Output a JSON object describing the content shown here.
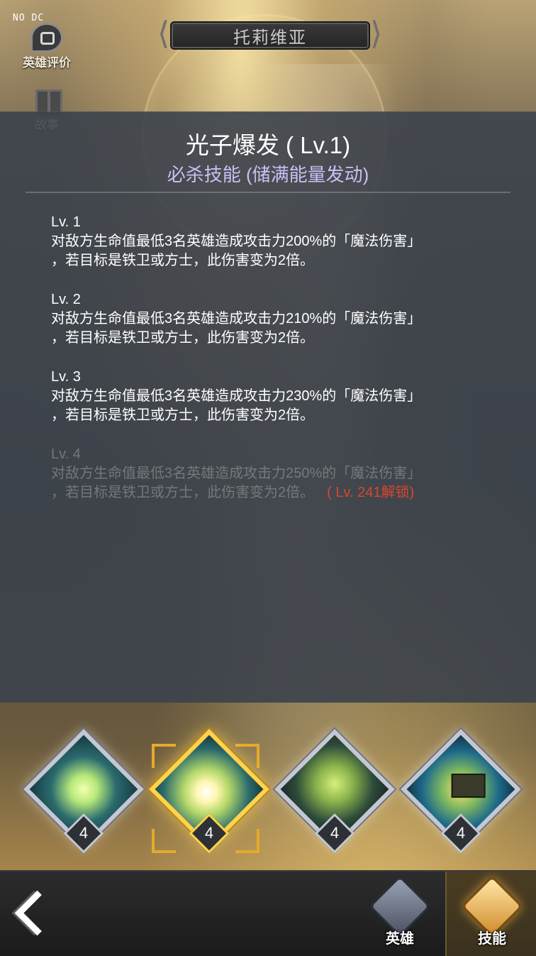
{
  "status": {
    "corner_text": "NO DC"
  },
  "side_menu": {
    "review_label": "英雄评价",
    "story_label": "故事"
  },
  "hero": {
    "name": "托莉维亚"
  },
  "skill_detail": {
    "title": "光子爆发 ( Lv.1)",
    "type": "必杀技能 (储满能量发动)",
    "levels": [
      {
        "label": "Lv. 1",
        "text": "对敌方生命值最低3名英雄造成攻击力200%的「魔法伤害」\n，若目标是铁卫或方士，此伤害变为2倍。",
        "locked": false
      },
      {
        "label": "Lv. 2",
        "text": "对敌方生命值最低3名英雄造成攻击力210%的「魔法伤害」\n，若目标是铁卫或方士，此伤害变为2倍。",
        "locked": false
      },
      {
        "label": "Lv. 3",
        "text": "对敌方生命值最低3名英雄造成攻击力230%的「魔法伤害」\n，若目标是铁卫或方士，此伤害变为2倍。",
        "locked": false
      },
      {
        "label": "Lv. 4",
        "line1": "对敌方生命值最低3名英雄造成攻击力250%的「魔法伤害」",
        "line2": "，若目标是铁卫或方士，此伤害变为2倍。",
        "unlock": "( Lv. 241解锁)",
        "locked": true
      }
    ]
  },
  "skills": [
    {
      "level": "4",
      "selected": false,
      "icon": "lightning-shield-icon"
    },
    {
      "level": "4",
      "selected": true,
      "icon": "photon-burst-icon"
    },
    {
      "level": "4",
      "selected": false,
      "icon": "ground-crack-icon"
    },
    {
      "level": "4",
      "selected": false,
      "icon": "banner-flag-icon"
    }
  ],
  "bottom_nav": {
    "hero_label": "英雄",
    "skill_label": "技能"
  },
  "colors": {
    "accent_gold": "#ffd34a",
    "skill_type": "#c9bff5",
    "unlock_red": "#d9462e"
  }
}
